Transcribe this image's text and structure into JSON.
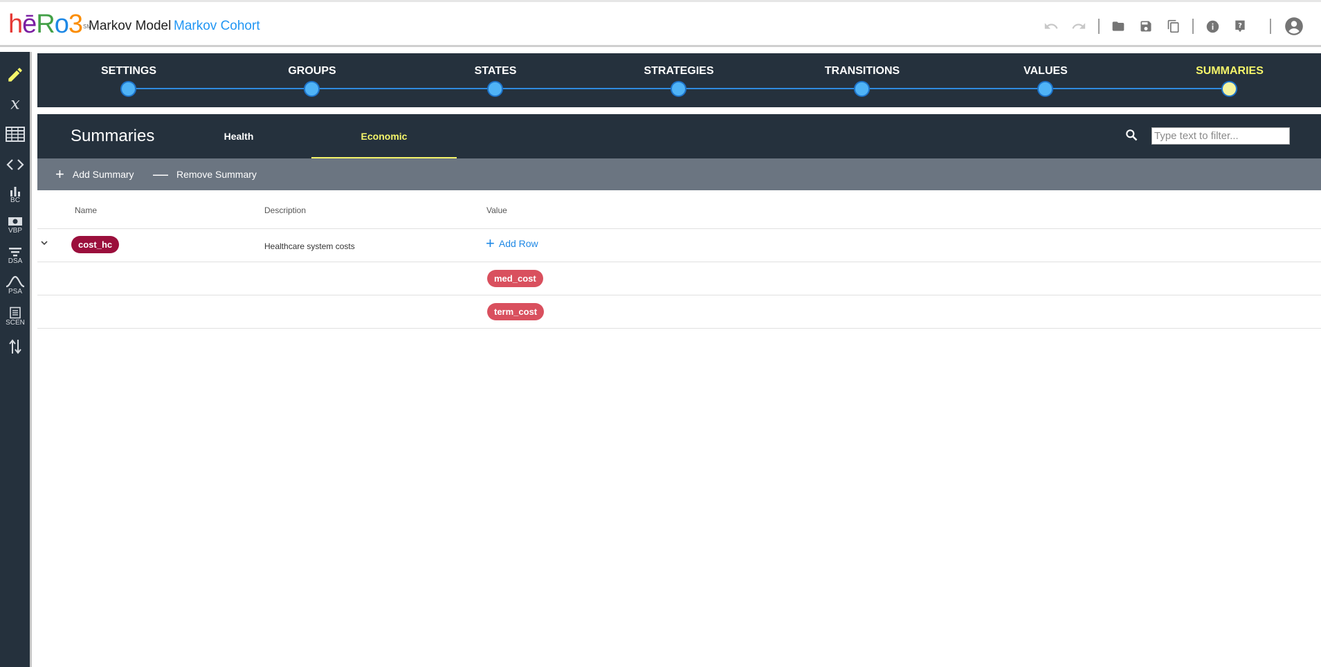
{
  "app": {
    "logo_letters": [
      "h",
      "ē",
      "R",
      "o",
      "3"
    ],
    "logo_colors": [
      "#e53935",
      "#7b1fa2",
      "#43a047",
      "#1e88e5",
      "#fb8c00"
    ],
    "logo_sm": "SM",
    "model_type": "Markov Model",
    "model_name": "Markov Cohort"
  },
  "toolbar_icons": [
    "undo-icon",
    "redo-icon",
    "folder-icon",
    "save-icon",
    "copy-icon",
    "info-icon",
    "help-icon",
    "account-icon"
  ],
  "sidebar": {
    "items": [
      {
        "icon": "pencil-icon",
        "label": ""
      },
      {
        "icon": "formula-x-icon",
        "label": ""
      },
      {
        "icon": "table-icon",
        "label": ""
      },
      {
        "icon": "code-icon",
        "label": ""
      },
      {
        "icon": "bar-chart-icon",
        "label": "BC"
      },
      {
        "icon": "money-icon",
        "label": "VBP"
      },
      {
        "icon": "filter-icon",
        "label": "DSA"
      },
      {
        "icon": "bell-curve-icon",
        "label": "PSA"
      },
      {
        "icon": "list-icon",
        "label": "SCEN"
      },
      {
        "icon": "sort-arrows-icon",
        "label": ""
      }
    ]
  },
  "workflow": {
    "steps": [
      "SETTINGS",
      "GROUPS",
      "STATES",
      "STRATEGIES",
      "TRANSITIONS",
      "VALUES",
      "SUMMARIES"
    ],
    "active": "SUMMARIES"
  },
  "summaries": {
    "title": "Summaries",
    "tabs": [
      "Health",
      "Economic"
    ],
    "active_tab": "Economic",
    "filter_placeholder": "Type text to filter..."
  },
  "actions": {
    "add_label": "Add Summary",
    "remove_label": "Remove Summary"
  },
  "table": {
    "columns": [
      "Name",
      "Description",
      "Value"
    ],
    "rows": [
      {
        "name": "cost_hc",
        "description": "Healthcare system costs",
        "add_row_label": "Add Row",
        "values": [
          "med_cost",
          "term_cost"
        ]
      }
    ]
  },
  "colors": {
    "dark_navy": "#25313d",
    "toolbar_grey": "#6b7581",
    "accent_yellow": "#f5f56a",
    "link_blue": "#1e88e5",
    "name_chip": "#9b0f3c",
    "value_chip": "#d9505e"
  }
}
